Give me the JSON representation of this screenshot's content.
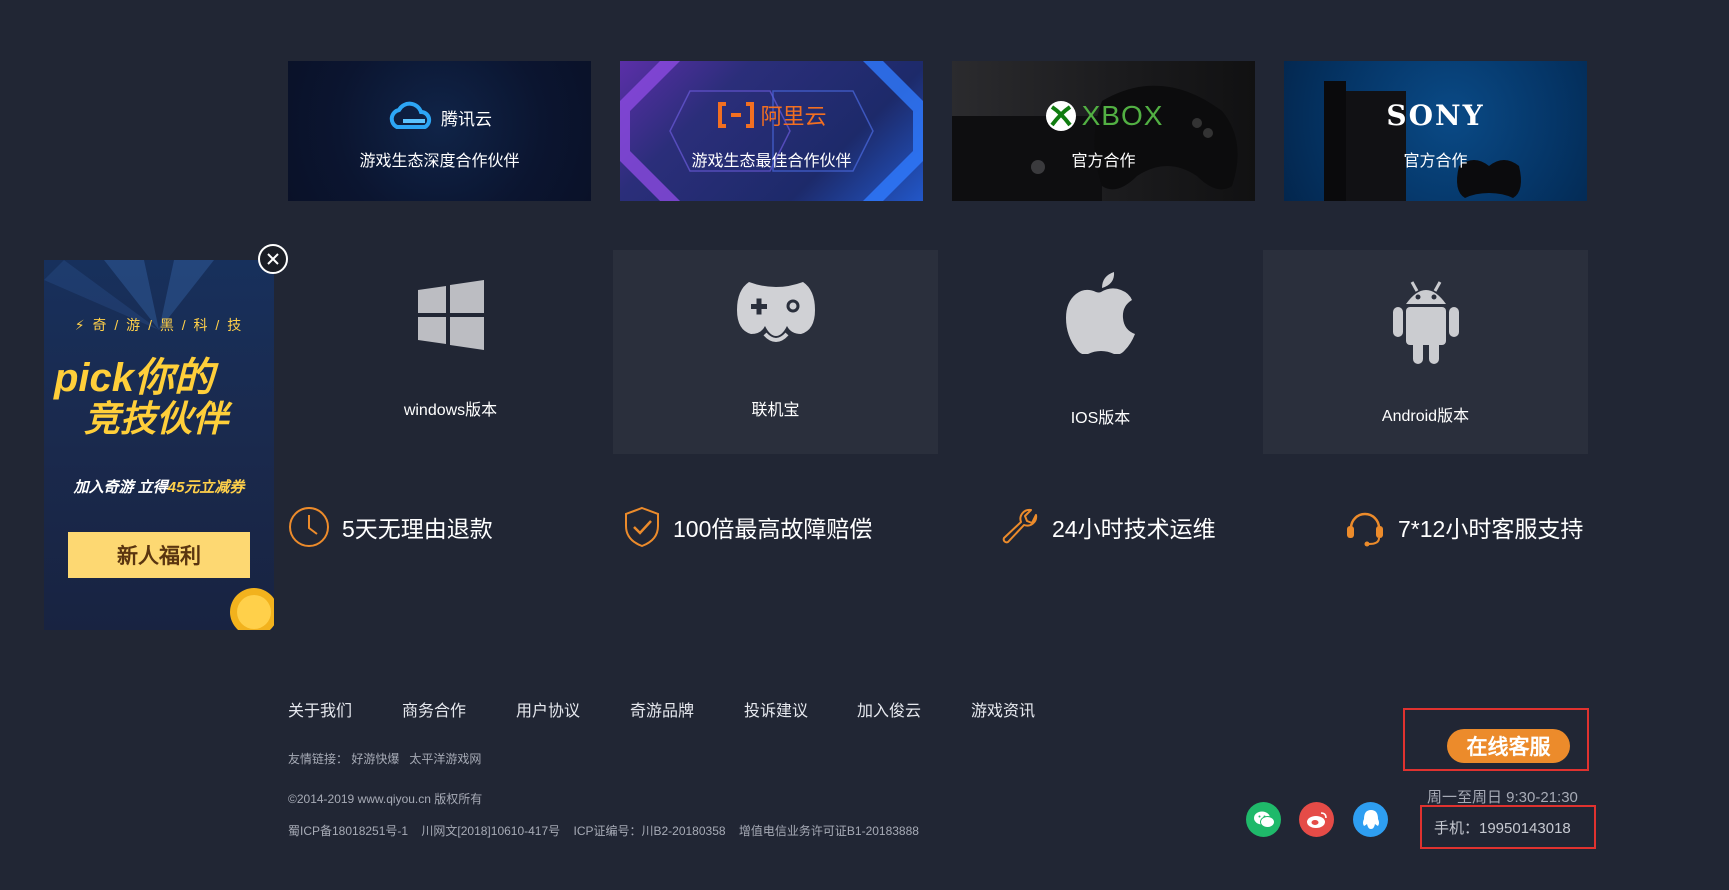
{
  "partners": [
    {
      "logo_text": "腾讯云",
      "caption": "游戏生态深度合作伙伴"
    },
    {
      "logo_text": "阿里云",
      "caption": "游戏生态最佳合作伙伴"
    },
    {
      "logo_text": "XBOX",
      "caption": "官方合作"
    },
    {
      "logo_text": "SONY",
      "caption": "官方合作"
    }
  ],
  "platforms": [
    {
      "label": "windows版本",
      "icon": "windows-icon"
    },
    {
      "label": "联机宝",
      "icon": "gamepad-icon"
    },
    {
      "label": "IOS版本",
      "icon": "apple-icon"
    },
    {
      "label": "Android版本",
      "icon": "android-icon"
    }
  ],
  "features": [
    {
      "text": "5天无理由退款",
      "icon": "clock-icon"
    },
    {
      "text": "100倍最高故障赔偿",
      "icon": "shield-check-icon"
    },
    {
      "text": "24小时技术运维",
      "icon": "wrench-icon"
    },
    {
      "text": "7*12小时客服支持",
      "icon": "headset-icon"
    }
  ],
  "footer": {
    "links": [
      "关于我们",
      "商务合作",
      "用户协议",
      "奇游品牌",
      "投诉建议",
      "加入俊云",
      "游戏资讯"
    ],
    "friend_label": "友情链接：",
    "friend_links": [
      "好游快爆",
      "太平洋游戏网"
    ],
    "copyright": "©2014-2019 www.qiyou.cn 版权所有",
    "licenses": "蜀ICP备18018251号-1    川网文[2018]10610-417号    ICP证编号：川B2-20180358    增值电信业务许可证B1-20183888"
  },
  "contact": {
    "online_service": "在线客服",
    "hours": "周一至周日 9:30-21:30",
    "phone": "手机：19950143018",
    "social": [
      "wechat-icon",
      "weibo-icon",
      "qq-icon"
    ]
  },
  "ad": {
    "tagline": "⚡ 奇 / 游 / 黑 / 科 / 技",
    "headline_1": "pick你的",
    "headline_2": "竞技伙伴",
    "sub_prefix": "加入奇游 立得",
    "sub_amount": "45元",
    "sub_suffix": "立减券",
    "button": "新人福利"
  },
  "colors": {
    "background": "#212634",
    "accent": "#ec8b2b",
    "highlight_border": "#e0322f"
  }
}
